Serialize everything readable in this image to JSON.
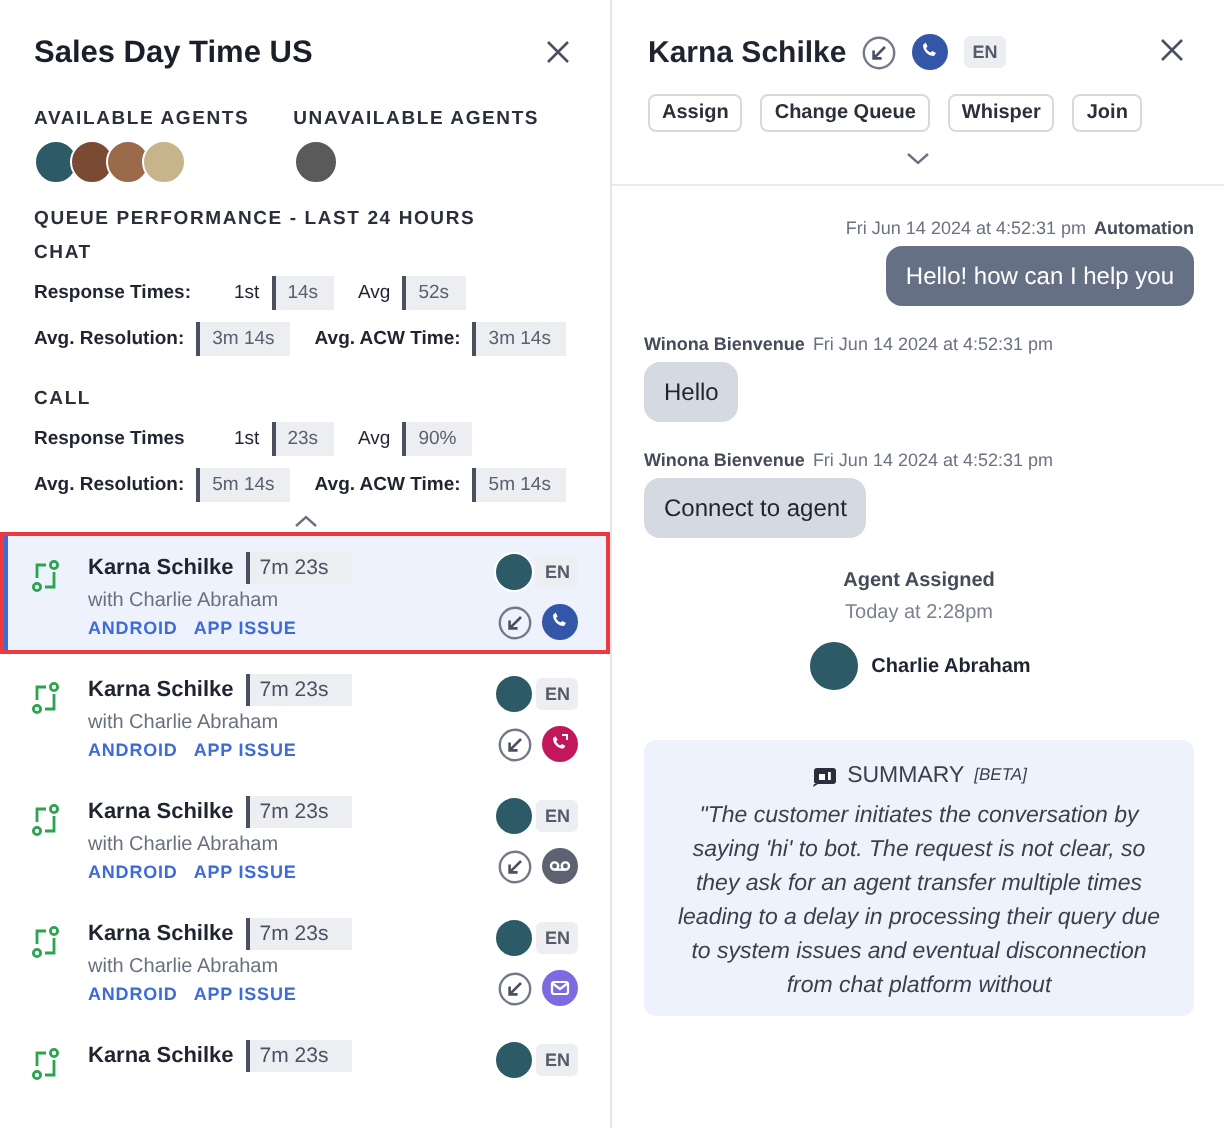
{
  "queue_panel": {
    "title": "Sales Day Time US",
    "available_label": "AVAILABLE AGENTS",
    "unavailable_label": "UNAVAILABLE AGENTS",
    "performance_title": "QUEUE PERFORMANCE - LAST 24 HOURS",
    "sections": [
      {
        "title": "CHAT",
        "rows": [
          {
            "kind": "response",
            "title": "Response Times:",
            "metrics": [
              {
                "label": "1st",
                "value": "14s"
              },
              {
                "label": "Avg",
                "value": "52s"
              }
            ]
          },
          {
            "kind": "duration",
            "metrics": [
              {
                "label": "Avg. Resolution:",
                "value": "3m 14s"
              },
              {
                "label": "Avg. ACW Time:",
                "value": "3m 14s"
              }
            ]
          }
        ]
      },
      {
        "title": "CALL",
        "rows": [
          {
            "kind": "response",
            "title": "Response Times",
            "metrics": [
              {
                "label": "1st",
                "value": "23s"
              },
              {
                "label": "Avg",
                "value": "90%"
              }
            ]
          },
          {
            "kind": "duration",
            "metrics": [
              {
                "label": "Avg. Resolution:",
                "value": "5m 14s"
              },
              {
                "label": "Avg. ACW Time:",
                "value": "5m 14s"
              }
            ]
          }
        ]
      }
    ],
    "conversations": [
      {
        "name": "Karna Schilke",
        "duration": "7m 23s",
        "with": "with Charlie Abraham",
        "tags": [
          "ANDROID",
          "APP ISSUE"
        ],
        "lang": "EN",
        "channel": {
          "kind": "call"
        },
        "selected": true
      },
      {
        "name": "Karna Schilke",
        "duration": "7m 23s",
        "with": "with Charlie Abraham",
        "tags": [
          "ANDROID",
          "APP ISSUE"
        ],
        "lang": "EN",
        "channel": {
          "kind": "transfer"
        },
        "selected": false
      },
      {
        "name": "Karna Schilke",
        "duration": "7m 23s",
        "with": "with Charlie Abraham",
        "tags": [
          "ANDROID",
          "APP ISSUE"
        ],
        "lang": "EN",
        "channel": {
          "kind": "voicemail"
        },
        "selected": false
      },
      {
        "name": "Karna Schilke",
        "duration": "7m 23s",
        "with": "with Charlie Abraham",
        "tags": [
          "ANDROID",
          "APP ISSUE"
        ],
        "lang": "EN",
        "channel": {
          "kind": "email"
        },
        "selected": false
      },
      {
        "name": "Karna Schilke",
        "duration": "7m 23s",
        "lang": "EN",
        "selected": false
      }
    ]
  },
  "detail_panel": {
    "name": "Karna Schilke",
    "channel": {
      "kind": "call"
    },
    "lang": "EN",
    "actions": [
      "Assign",
      "Change Queue",
      "Whisper",
      "Join"
    ],
    "messages": [
      {
        "kind": "outgoing",
        "time": "Fri Jun 14 2024 at 4:52:31 pm",
        "author": "Automation",
        "text": "Hello! how can I help you"
      },
      {
        "kind": "incoming",
        "author": "Winona Bienvenue",
        "time": "Fri Jun 14 2024 at 4:52:31 pm",
        "text": "Hello"
      },
      {
        "kind": "incoming",
        "author": "Winona Bienvenue",
        "time": "Fri Jun 14 2024 at 4:52:31 pm",
        "text": "Connect to agent"
      }
    ],
    "event": {
      "title": "Agent Assigned",
      "time": "Today at 2:28pm",
      "agent": "Charlie Abraham"
    },
    "summary": {
      "title": "SUMMARY",
      "badge": "[BETA]",
      "text": "\"The customer initiates the conversation by saying 'hi' to bot. The request is not clear, so they ask for an agent transfer multiple times leading to a delay in processing their query due to system issues and eventual disconnection from chat platform without"
    }
  }
}
